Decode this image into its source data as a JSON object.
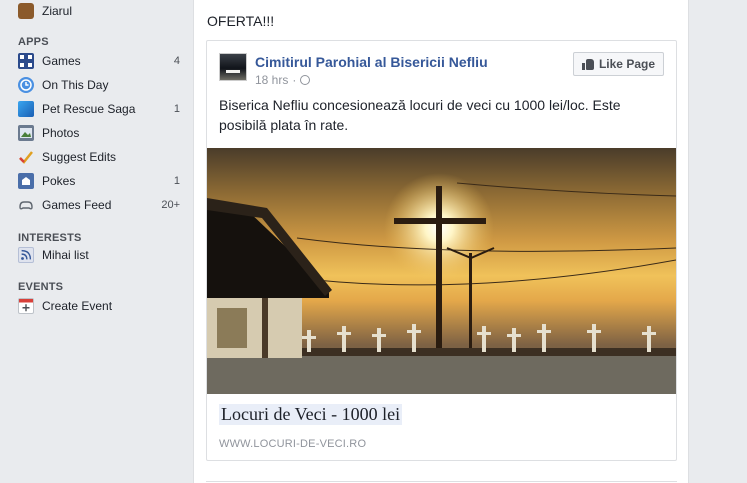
{
  "sidebar": {
    "top_item": {
      "label": "Ziarul",
      "icon": "briefcase-icon"
    },
    "apps_header": "APPS",
    "apps": [
      {
        "label": "Games",
        "count": "4",
        "icon": "games-icon"
      },
      {
        "label": "On This Day",
        "count": "",
        "icon": "clock-icon"
      },
      {
        "label": "Pet Rescue Saga",
        "count": "1",
        "icon": "pet-rescue-icon"
      },
      {
        "label": "Photos",
        "count": "",
        "icon": "photos-icon"
      },
      {
        "label": "Suggest Edits",
        "count": "",
        "icon": "checkmark-icon"
      },
      {
        "label": "Pokes",
        "count": "1",
        "icon": "poke-icon"
      },
      {
        "label": "Games Feed",
        "count": "20+",
        "icon": "gamepad-icon"
      }
    ],
    "interests_header": "INTERESTS",
    "interests": [
      {
        "label": "Mihai list",
        "icon": "feed-icon"
      }
    ],
    "events_header": "EVENTS",
    "events": [
      {
        "label": "Create Event",
        "icon": "calendar-plus-icon"
      }
    ]
  },
  "post": {
    "status_text": "OFERTA!!!",
    "shared": {
      "page_name": "Cimitirul Parohial al Bisericii Nefliu",
      "time": "18 hrs",
      "separator": "·",
      "like_button": "Like Page",
      "body": "Biserica Nefliu concesionează locuri de veci cu 1000 lei/loc. Este posibilă plata în rate.",
      "link_title": "Locuri de Veci - 1000 lei",
      "link_domain": "WWW.LOCURI-DE-VECI.RO"
    }
  },
  "colors": {
    "background": "#e9ebee",
    "link_blue": "#365899",
    "muted": "#90949c",
    "sunset": "#f0c25a"
  }
}
